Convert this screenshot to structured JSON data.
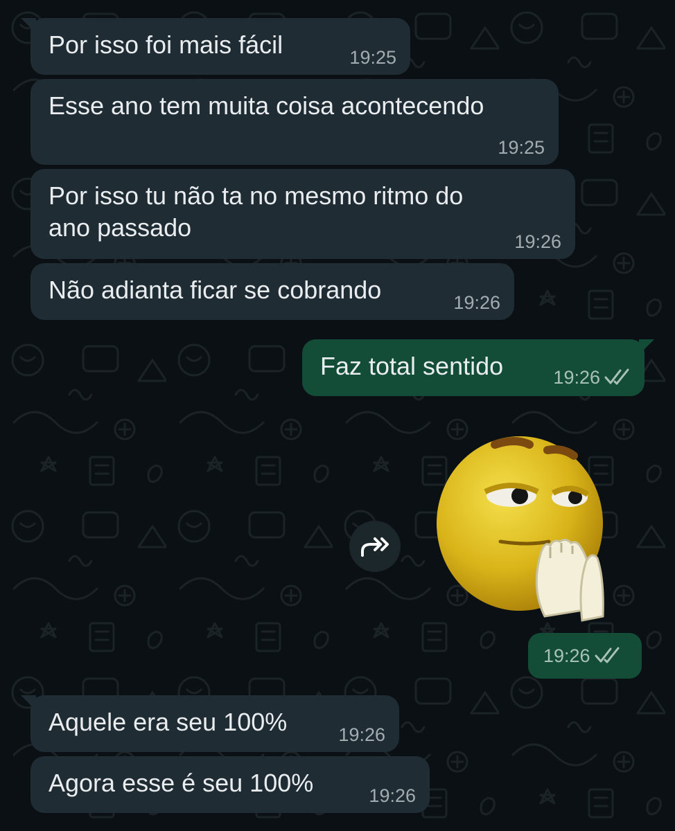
{
  "chat": {
    "messages": [
      {
        "direction": "incoming",
        "text": "Por isso foi mais fácil",
        "time": "19:25"
      },
      {
        "direction": "incoming",
        "text": "Esse ano tem muita coisa acontecendo",
        "time": "19:25"
      },
      {
        "direction": "incoming",
        "text_line1": "Por isso tu não ta no mesmo ritmo do",
        "text_line2": "ano passado",
        "time": "19:26"
      },
      {
        "direction": "incoming",
        "text": "Não adianta ficar se cobrando",
        "time": "19:26"
      },
      {
        "direction": "outgoing",
        "text": "Faz total sentido",
        "time": "19:26",
        "status": "read"
      },
      {
        "direction": "outgoing",
        "type": "sticker",
        "sticker": "thinking-emoji-sticker",
        "time": "19:26",
        "status": "read"
      },
      {
        "direction": "incoming",
        "text": "Aquele era seu 100%",
        "time": "19:26"
      },
      {
        "direction": "incoming",
        "text": "Agora esse é seu 100%",
        "time": "19:26"
      }
    ]
  },
  "icons": {
    "forward": "forward-arrow-icon",
    "read_ticks": "double-check-icon"
  },
  "colors": {
    "background": "#0b1014",
    "incoming_bubble": "#1f2c33",
    "outgoing_bubble": "#144d37",
    "text": "#e9edef",
    "timestamp": "#a3acb1"
  }
}
